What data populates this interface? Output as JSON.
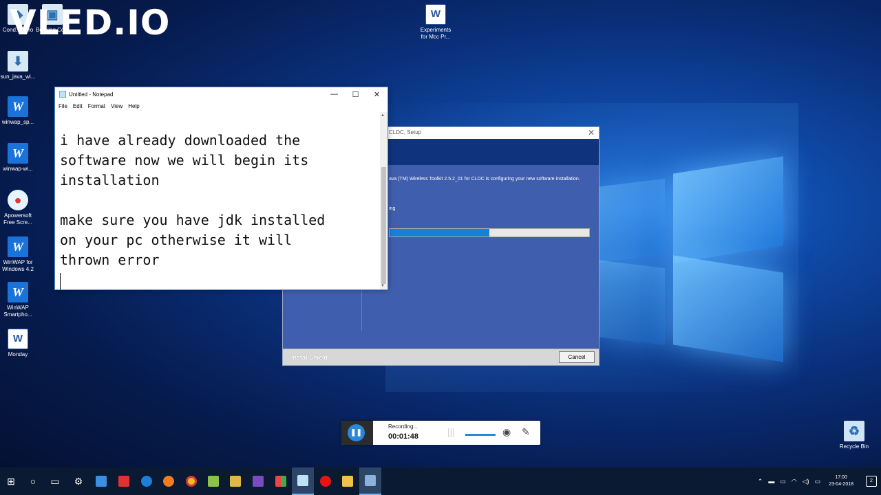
{
  "watermark": "VLED.IO",
  "desktop_icons": [
    {
      "label": "Cond... Zero",
      "icon": "app-icon"
    },
    {
      "label": "Booking Co...",
      "icon": "app-icon"
    },
    {
      "label": "sun_java_wi...",
      "icon": "installer-icon"
    },
    {
      "label": "winwap_sp...",
      "icon": "winwap-icon"
    },
    {
      "label": "winwap-wi...",
      "icon": "winwap-icon"
    },
    {
      "label": "Apowersoft Free Scre...",
      "icon": "recorder-icon"
    },
    {
      "label": "WinWAP for Windows 4.2",
      "icon": "winwap-icon"
    },
    {
      "label": "WinWAP Smartpho...",
      "icon": "winwap-icon"
    },
    {
      "label": "Monday",
      "icon": "word-doc-icon"
    },
    {
      "label": "Experiments for Mcc Pr...",
      "icon": "word-doc-icon"
    },
    {
      "label": "Recycle Bin",
      "icon": "recycle-bin-icon"
    }
  ],
  "setup_window": {
    "title": "CLDC, Setup",
    "message": "ava (TM) Wireless Toolkit 2.5.2_01 for CLDC is configuring your new software installation.",
    "status": "ing",
    "progress_fraction": 0.5,
    "brand": "InstallShield",
    "cancel_label": "Cancel"
  },
  "notepad": {
    "title": "Untitled - Notepad",
    "menu": [
      "File",
      "Edit",
      "Format",
      "View",
      "Help"
    ],
    "content": "i have already downloaded the\nsoftware now we will begin its\ninstallation\n\nmake sure you have jdk installed\non your pc otherwise it will\nthrown error\n"
  },
  "recorder": {
    "label": "Recording...",
    "time": "00:01:48"
  },
  "taskbar": {
    "time": "17:00",
    "date": "23-04-2018",
    "notification_count": "2"
  }
}
